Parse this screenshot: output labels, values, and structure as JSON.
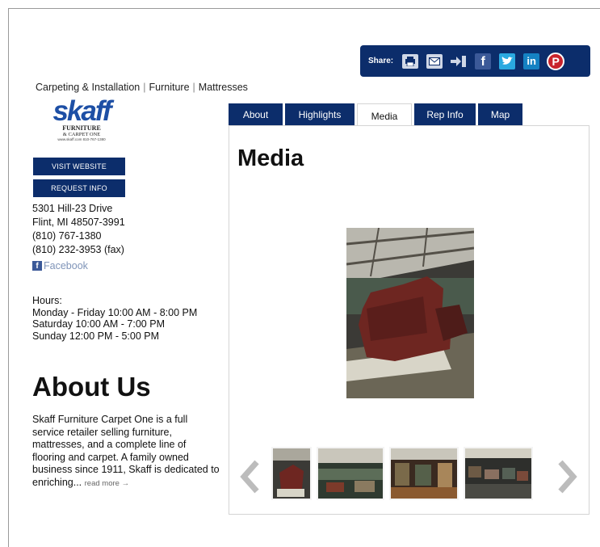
{
  "share": {
    "label": "Share:",
    "icons": [
      "print-icon",
      "email-icon",
      "export-icon",
      "facebook-icon",
      "twitter-icon",
      "linkedin-icon",
      "pinterest-icon"
    ],
    "facebook_glyph": "f",
    "linkedin_glyph": "in",
    "pinterest_glyph": "P"
  },
  "categories": [
    "Carpeting & Installation",
    "Furniture",
    "Mattresses"
  ],
  "logo": {
    "name": "skaff",
    "line1": "FURNITURE",
    "line2": "& CARPET ONE",
    "tiny": "www.skaff.com  810-767-1380"
  },
  "buttons": {
    "visit_website": "VISIT WEBSITE",
    "request_info": "REQUEST INFO"
  },
  "contact": {
    "street": "5301 Hill-23 Drive",
    "city": "Flint, MI 48507-3991",
    "phone": "(810) 767-1380",
    "fax": "(810) 232-3953 (fax)",
    "facebook": "Facebook",
    "facebook_glyph": "f"
  },
  "hours": {
    "label": "Hours:",
    "weekdays": "Monday - Friday 10:00 AM - 8:00 PM",
    "saturday": "Saturday 10:00 AM - 7:00 PM",
    "sunday": "Sunday 12:00 PM - 5:00 PM"
  },
  "about": {
    "title": "About Us",
    "text": "Skaff Furniture Carpet One is a full service retailer selling furniture, mattresses, and a complete line of flooring and carpet. A family owned business since 1911, Skaff is dedicated to enriching...",
    "read_more": "read more →"
  },
  "tabs": [
    "About",
    "Highlights",
    "Media",
    "Rep Info",
    "Map"
  ],
  "active_tab": "Media",
  "panel": {
    "title": "Media"
  },
  "colors": {
    "navy": "#0c2d6b",
    "brand_blue": "#1d4fa5"
  }
}
